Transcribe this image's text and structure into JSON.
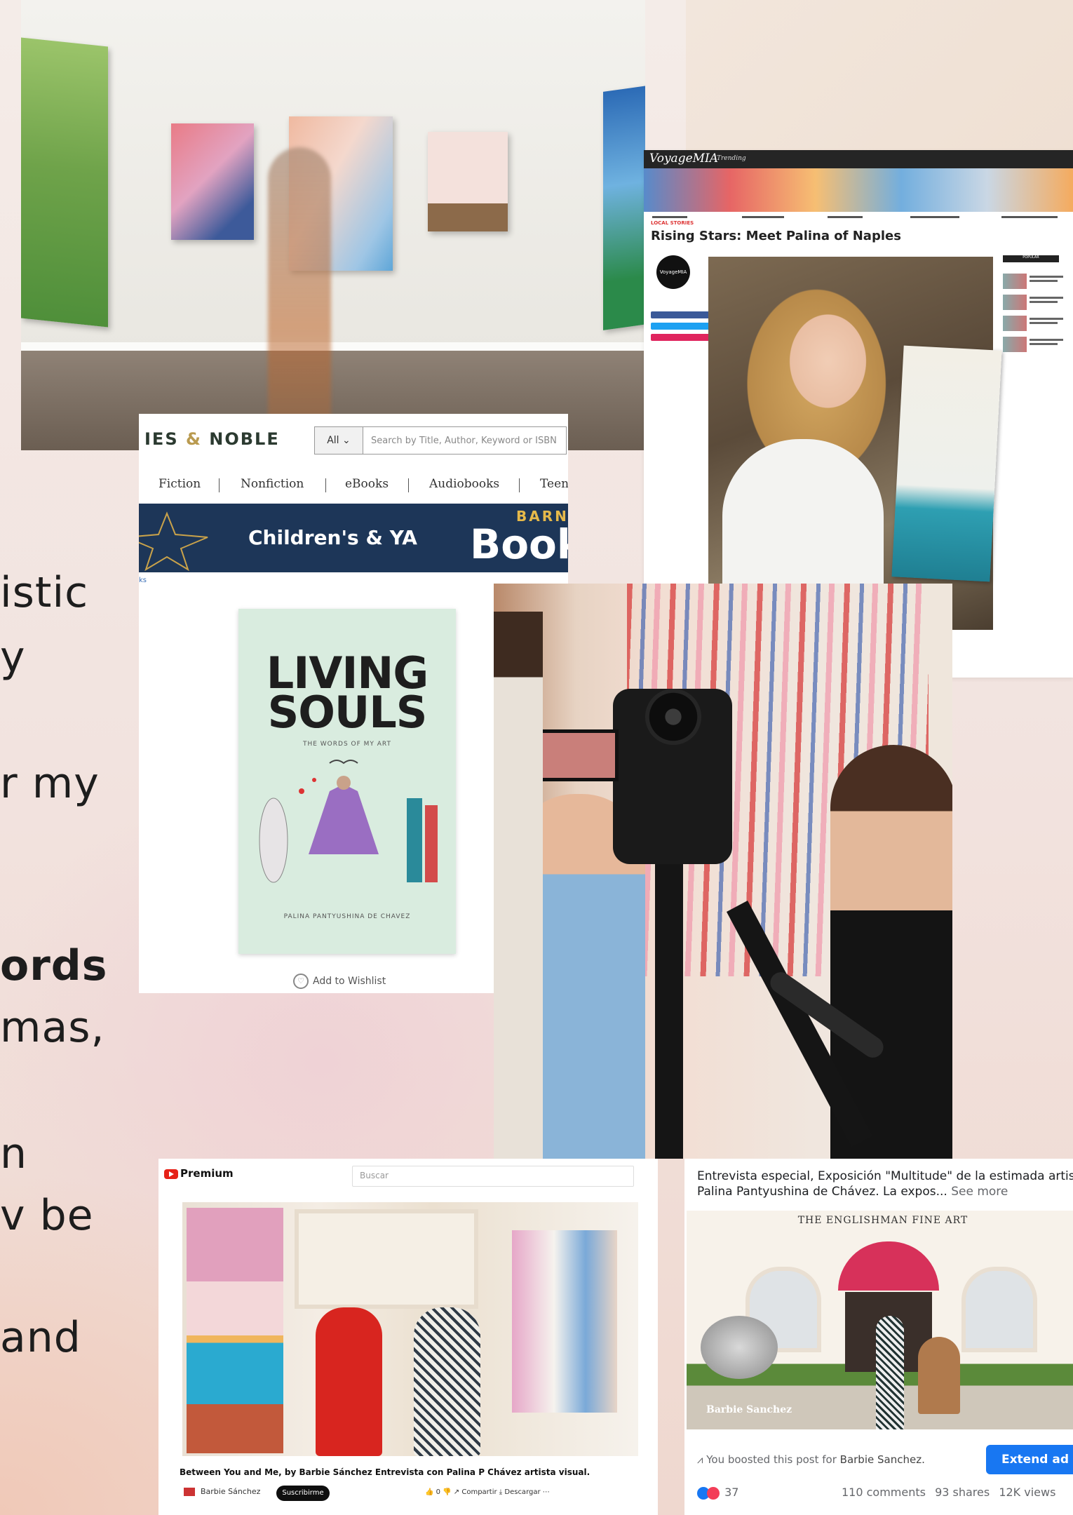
{
  "side_text": {
    "line1": "istic",
    "line2": "y",
    "line3": "r my",
    "line4": "ords",
    "line5": "mas,",
    "line6": "n",
    "line7": "v be",
    "line8": "and"
  },
  "voyage": {
    "logo": "VoyageMIA",
    "nav_item": "Trending",
    "kicker": "LOCAL STORIES",
    "title": "Rising Stars: Meet Palina of Naples",
    "avatar_text": "VoyageMIA",
    "sidebar_heading": "POPULAR",
    "share_colors": [
      "#3b5998",
      "#1da1f2",
      "#e0245e"
    ]
  },
  "barnes_noble": {
    "logo_left": "IES",
    "logo_amp": "&",
    "logo_right": "NOBLE",
    "search_select": "All",
    "search_placeholder": "Search by Title, Author, Keyword or ISBN",
    "nav": [
      "Fiction",
      "Nonfiction",
      "eBooks",
      "Audiobooks",
      "Teen"
    ],
    "banner_text": "Children's & YA",
    "banner_barn": "BARN",
    "banner_book": "Book",
    "tiny": "ks",
    "book": {
      "title_line1": "LIVING",
      "title_line2": "SOULS",
      "subtitle": "THE WORDS OF MY ART",
      "author": "PALINA PANTYUSHINA DE CHAVEZ"
    },
    "wishlist": "Add to Wishlist"
  },
  "youtube": {
    "logo": "Premium",
    "search_placeholder": "Buscar",
    "caption": "Between You and Me, by Barbie Sánchez Entrevista con Palina P Chávez artista visual.",
    "channel": "Barbie Sánchez",
    "subscribe": "Suscribirme",
    "actions": "👍 0    👎    ↗ Compartir    ⤓ Descargar    ⋯"
  },
  "facebook": {
    "post_text": "Entrevista especial, Exposición \"Multitude\" de la estimada artista Palina Pantyushina de Chávez. La expos...",
    "see_more": "See more",
    "store_name": "THE ENGLISHMAN FINE ART",
    "watermark": "Barbie Sanchez",
    "boost_prefix": "You boosted this post for",
    "boost_name": "Barbie Sanchez.",
    "extend_button": "Extend ad",
    "reaction_count": "37",
    "comments": "110 comments",
    "shares": "93 shares",
    "views": "12K views"
  }
}
